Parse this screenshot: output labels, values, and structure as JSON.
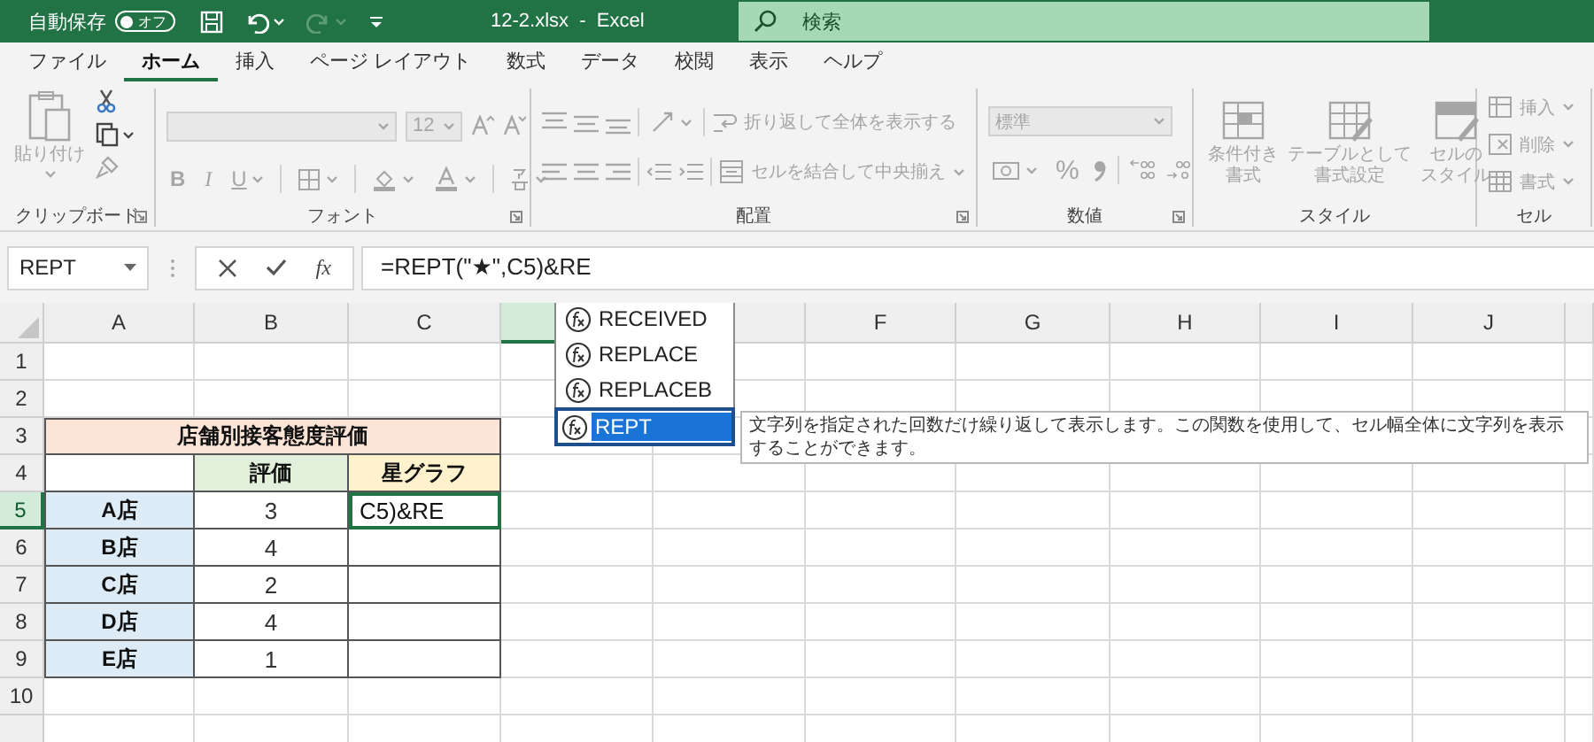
{
  "title_bar": {
    "autosave_label": "自動保存",
    "autosave_toggle": {
      "label": "オフ",
      "on": false
    },
    "title": "12-2.xlsx  -  Excel",
    "search": {
      "placeholder": "検索"
    }
  },
  "ribbon_tabs": [
    {
      "label": "ファイル",
      "selected": false
    },
    {
      "label": "ホーム",
      "selected": true
    },
    {
      "label": "挿入",
      "selected": false
    },
    {
      "label": "ページ レイアウト",
      "selected": false
    },
    {
      "label": "数式",
      "selected": false
    },
    {
      "label": "データ",
      "selected": false
    },
    {
      "label": "校閲",
      "selected": false
    },
    {
      "label": "表示",
      "selected": false
    },
    {
      "label": "ヘルプ",
      "selected": false
    }
  ],
  "ribbon": {
    "disabled": true,
    "clipboard": {
      "paste_label": "貼り付け",
      "group_label": "クリップボード"
    },
    "font": {
      "size": "12",
      "bold": "B",
      "italic": "I",
      "underline": "U",
      "group_label": "フォント"
    },
    "alignment": {
      "wrap_label": "折り返して全体を表示する",
      "merge_label": "セルを結合して中央揃え",
      "group_label": "配置"
    },
    "number": {
      "format": "標準",
      "percent": "%",
      "group_label": "数値"
    },
    "styles": {
      "buttons": [
        [
          "条件付き",
          "書式"
        ],
        [
          "テーブルとして",
          "書式設定"
        ],
        [
          "セルの",
          "スタイル"
        ]
      ],
      "group_label": "スタイル"
    },
    "cells": {
      "buttons": [
        "挿入",
        "削除",
        "書式"
      ],
      "group_label": "セル"
    }
  },
  "formula_bar": {
    "name_box": "REPT",
    "fx_label": "fx",
    "formula": "=REPT(\"★\",C5)&RE"
  },
  "sheet": {
    "columns": [
      {
        "label": "A",
        "selected": false
      },
      {
        "label": "B",
        "selected": false
      },
      {
        "label": "C",
        "selected": false
      },
      {
        "selected": true
      },
      {
        "selected": false
      },
      {
        "label": "F",
        "selected": false
      },
      {
        "label": "G",
        "selected": false
      },
      {
        "label": "H",
        "selected": false
      },
      {
        "label": "I",
        "selected": false
      },
      {
        "label": "J",
        "selected": false
      }
    ],
    "rows": [
      {
        "label": "1",
        "selected": false
      },
      {
        "label": "2",
        "selected": false
      },
      {
        "label": "3",
        "selected": false
      },
      {
        "label": "4",
        "selected": false
      },
      {
        "label": "5",
        "selected": true
      },
      {
        "label": "6",
        "selected": false
      },
      {
        "label": "7",
        "selected": false
      },
      {
        "label": "8",
        "selected": false
      },
      {
        "label": "9",
        "selected": false
      },
      {
        "label": "10",
        "selected": false
      },
      {
        "selected": false
      }
    ],
    "table": {
      "title": "店舗別接客態度評価",
      "headers": [
        "評価",
        "星グラフ"
      ],
      "rows": [
        {
          "store": "A店",
          "rating": "3",
          "graph": "C5)&RE",
          "editing": true
        },
        {
          "store": "B店",
          "rating": "4",
          "editing": false
        },
        {
          "store": "C店",
          "rating": "2",
          "editing": false
        },
        {
          "store": "D店",
          "rating": "4",
          "editing": false
        },
        {
          "store": "E店",
          "rating": "1",
          "editing": false
        }
      ]
    },
    "autocomplete": [
      {
        "label": "RECEIVED",
        "selected": false
      },
      {
        "label": "REPLACE",
        "selected": false
      },
      {
        "label": "REPLACEB",
        "selected": false
      },
      {
        "label": "REPT",
        "selected": true
      }
    ],
    "tooltip": "文字列を指定された回数だけ繰り返して表示します。この関数を使用して、セル幅全体に文字列を表示することができます。"
  }
}
